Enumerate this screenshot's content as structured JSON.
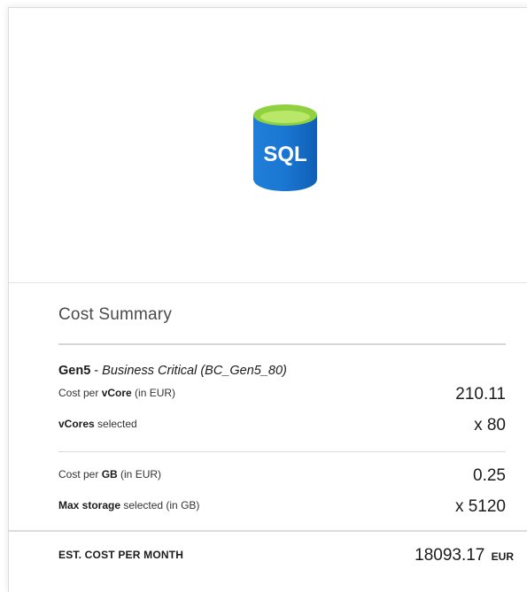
{
  "product": {
    "icon_name": "sql-database-icon",
    "icon_text": "SQL",
    "colors": {
      "cylinder": "#1a76d2",
      "cylinder_dark": "#0f5fb5",
      "top": "#8fd13f",
      "top_inner": "#b9e76a"
    }
  },
  "summary": {
    "title": "Cost Summary",
    "tier": {
      "generation": "Gen5",
      "separator": " - ",
      "sku": "Business Critical (BC_Gen5_80)"
    },
    "rows": [
      {
        "label_prefix": "Cost per ",
        "label_bold": "vCore",
        "label_suffix": " (in EUR)",
        "value": "210.11"
      },
      {
        "label_prefix": "",
        "label_bold": "vCores",
        "label_suffix": " selected",
        "value": "x 80"
      },
      {
        "label_prefix": "Cost per ",
        "label_bold": "GB",
        "label_suffix": " (in EUR)",
        "value": "0.25"
      },
      {
        "label_prefix": "",
        "label_bold": "Max storage",
        "label_suffix": " selected (in GB)",
        "value": "x 5120"
      }
    ]
  },
  "total": {
    "label": "EST. COST PER MONTH",
    "amount": "18093.17",
    "currency": "EUR"
  }
}
